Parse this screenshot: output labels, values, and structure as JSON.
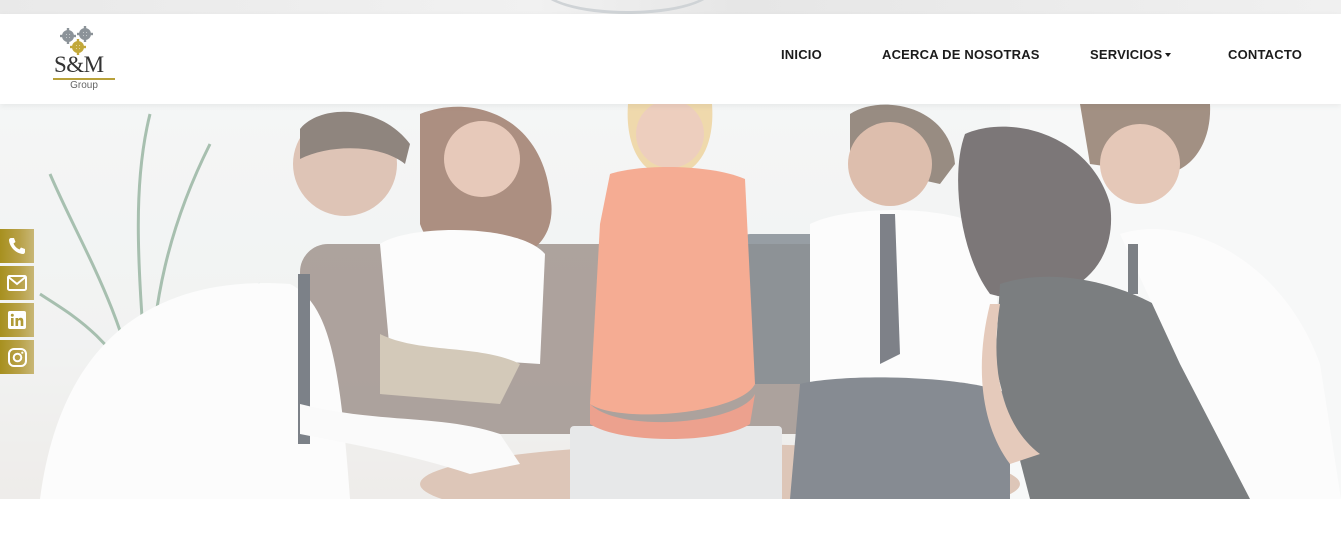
{
  "brand": {
    "logo_mark": "S&M",
    "logo_sub": "Group",
    "logo_icon": "gears-icon",
    "accent_color": "#b8a13a"
  },
  "nav": {
    "items": [
      {
        "label": "INICIO"
      },
      {
        "label": "ACERCA DE NOSOTRAS"
      },
      {
        "label": "SERVICIOS",
        "has_dropdown": true
      },
      {
        "label": "CONTACTO"
      }
    ]
  },
  "hero": {
    "image_subject": "team-meeting-photo"
  },
  "social": {
    "color": "#b39b35",
    "items": [
      {
        "icon": "phone-icon"
      },
      {
        "icon": "envelope-icon"
      },
      {
        "icon": "linkedin-icon"
      },
      {
        "icon": "instagram-icon"
      }
    ]
  }
}
